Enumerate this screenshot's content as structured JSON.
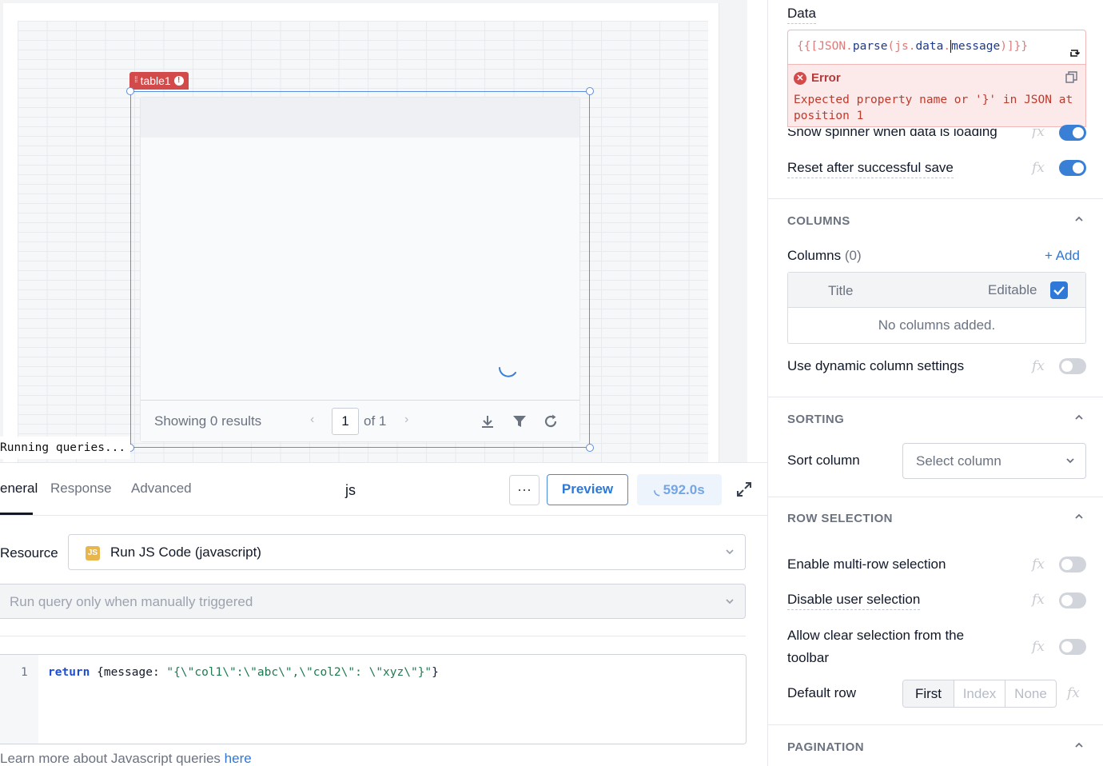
{
  "canvas": {
    "widget_name": "table1",
    "running_text": "Running queries...",
    "table": {
      "results_text": "Showing 0 results",
      "page_value": "1",
      "of_text": "of 1",
      "prev_glyph": "‹",
      "next_glyph": "›"
    }
  },
  "query": {
    "tabs": [
      "eneral",
      "Response",
      "Advanced"
    ],
    "active_tab": "eneral",
    "name": "js",
    "more_label": "···",
    "preview_label": "Preview",
    "run_label": "592.0s",
    "resource_label": "Resource",
    "resource_badge": "JS",
    "resource_value": "Run JS Code (javascript)",
    "trigger_value": "Run query only when manually triggered",
    "line_number": "1",
    "code": {
      "keyword": "return",
      "open": " {message: ",
      "string": "\"{\\\"col1\\\":\\\"abc\\\",\\\"col2\\\": \\\"xyz\\\"}\"",
      "close": "}"
    },
    "learn_text": "Learn more about Javascript queries ",
    "learn_link": "here"
  },
  "inspector": {
    "data_label": "Data",
    "data_code": {
      "p1": "{{[",
      "p2": "JSON",
      "p3": ".",
      "p4": "parse",
      "p5": "(",
      "p6": "js",
      "p7": ".",
      "p8": "data",
      "p9": ".",
      "p10": "message",
      "p11": ")]}}"
    },
    "error_title": "Error",
    "error_message": "Expected property name or '}' in JSON at position 1",
    "show_spinner_label": "Show spinner when data is loading",
    "reset_label": "Reset after successful save",
    "fx_label": "fx",
    "sections": {
      "columns": "COLUMNS",
      "sorting": "SORTING",
      "row_selection": "ROW SELECTION",
      "pagination": "PAGINATION"
    },
    "columns_label": "Columns",
    "columns_count": "(0)",
    "add_label": "+ Add",
    "col_title": "Title",
    "col_editable": "Editable",
    "no_columns": "No columns added.",
    "dynamic_label": "Use dynamic column settings",
    "sort_label": "Sort column",
    "sort_placeholder": "Select column",
    "multi_row_label": "Enable multi-row selection",
    "disable_sel_label": "Disable user selection",
    "allow_clear_label_1": "Allow clear selection from the",
    "allow_clear_label_2": "toolbar",
    "default_row_label": "Default row",
    "default_row_options": [
      "First",
      "Index",
      "None"
    ]
  },
  "colors": {
    "accent": "#2f78d8",
    "error": "#d24a4a",
    "toggle_on": "#3a7fd6",
    "toggle_off": "#d1d5db"
  },
  "toggles": {
    "show_spinner": true,
    "reset_after_save": true,
    "dynamic_columns": false,
    "multi_row": false,
    "disable_user_selection": false,
    "allow_clear": false
  }
}
